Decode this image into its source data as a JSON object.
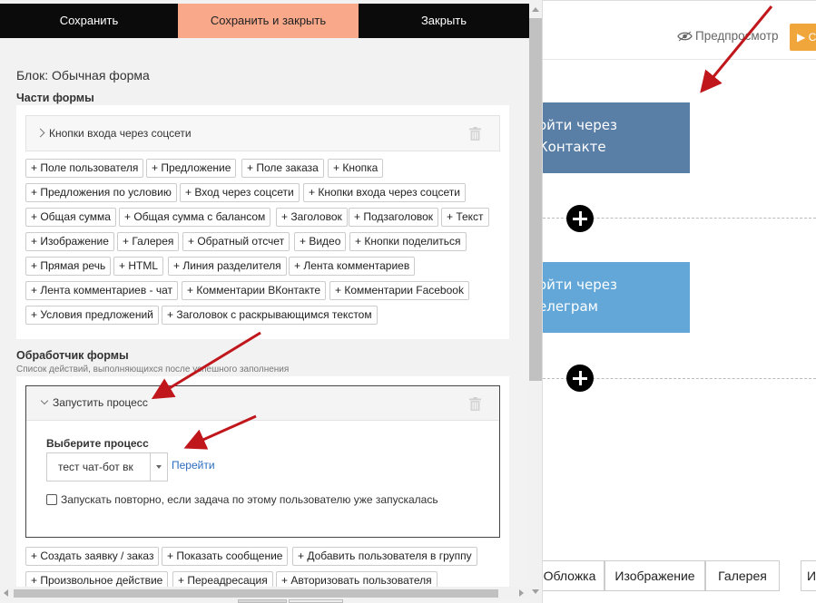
{
  "modal": {
    "toolbar": {
      "save": "Сохранить",
      "save_close": "Сохранить и закрыть",
      "close": "Закрыть"
    },
    "block_title": "Блок: Обычная форма",
    "parts_title": "Части формы",
    "parts_panel_label": "Кнопки входа через соцсети",
    "parts_chips": [
      "+ Поле пользователя",
      "+ Предложение",
      "+ Поле заказа",
      "+ Кнопка",
      "+ Предложения по условию",
      "+ Вход через соцсети",
      "+ Кнопки входа через соцсети",
      "+ Общая сумма",
      "+ Общая сумма с балансом",
      "+ Заголовок",
      "+ Подзаголовок",
      "+ Текст",
      "+ Изображение",
      "+ Галерея",
      "+ Обратный отсчет",
      "+ Видео",
      "+ Кнопки поделиться",
      "+ Прямая речь",
      "+ HTML",
      "+ Линия разделителя",
      "+ Лента комментариев",
      "+ Лента комментариев - чат",
      "+ Комментарии ВКонтакте",
      "+ Комментарии Facebook",
      "+ Условия предложений",
      "+ Заголовок с раскрывающимся текстом"
    ],
    "handler_title": "Обработчик формы",
    "handler_sub": "Список действий, выполняющихся после успешного заполнения",
    "process": {
      "header": "Запустить процесс",
      "select_label": "Выберите процесс",
      "select_value": "тест чат-бот вк",
      "link": "Перейти",
      "checkbox_label": "Запускать повторно, если задача по этому пользователю уже запускалась"
    },
    "handler_chips": [
      "+ Создать заявку / заказ",
      "+ Показать сообщение",
      "+ Добавить пользователя в группу",
      "+ Произвольное действие",
      "+ Переадресация",
      "+ Авторизовать пользователя"
    ]
  },
  "editor": {
    "preview_label": "Предпросмотр",
    "start_label": "▶ С",
    "vk_button_lines": [
      "ойти через",
      "Контакте"
    ],
    "tg_button_lines": [
      "ойти через",
      "елеграм"
    ],
    "bottom_tabs": [
      "Обложка",
      "Изображение",
      "Галерея",
      "И"
    ]
  },
  "colors": {
    "accent_save_close": "#f9a88a",
    "toolbar_dark": "#0b0b0b",
    "vk_blue": "#5a7fa7",
    "tg_blue": "#62a7d8",
    "annotation_arrow": "#c0171c",
    "link": "#2a6cbf"
  }
}
